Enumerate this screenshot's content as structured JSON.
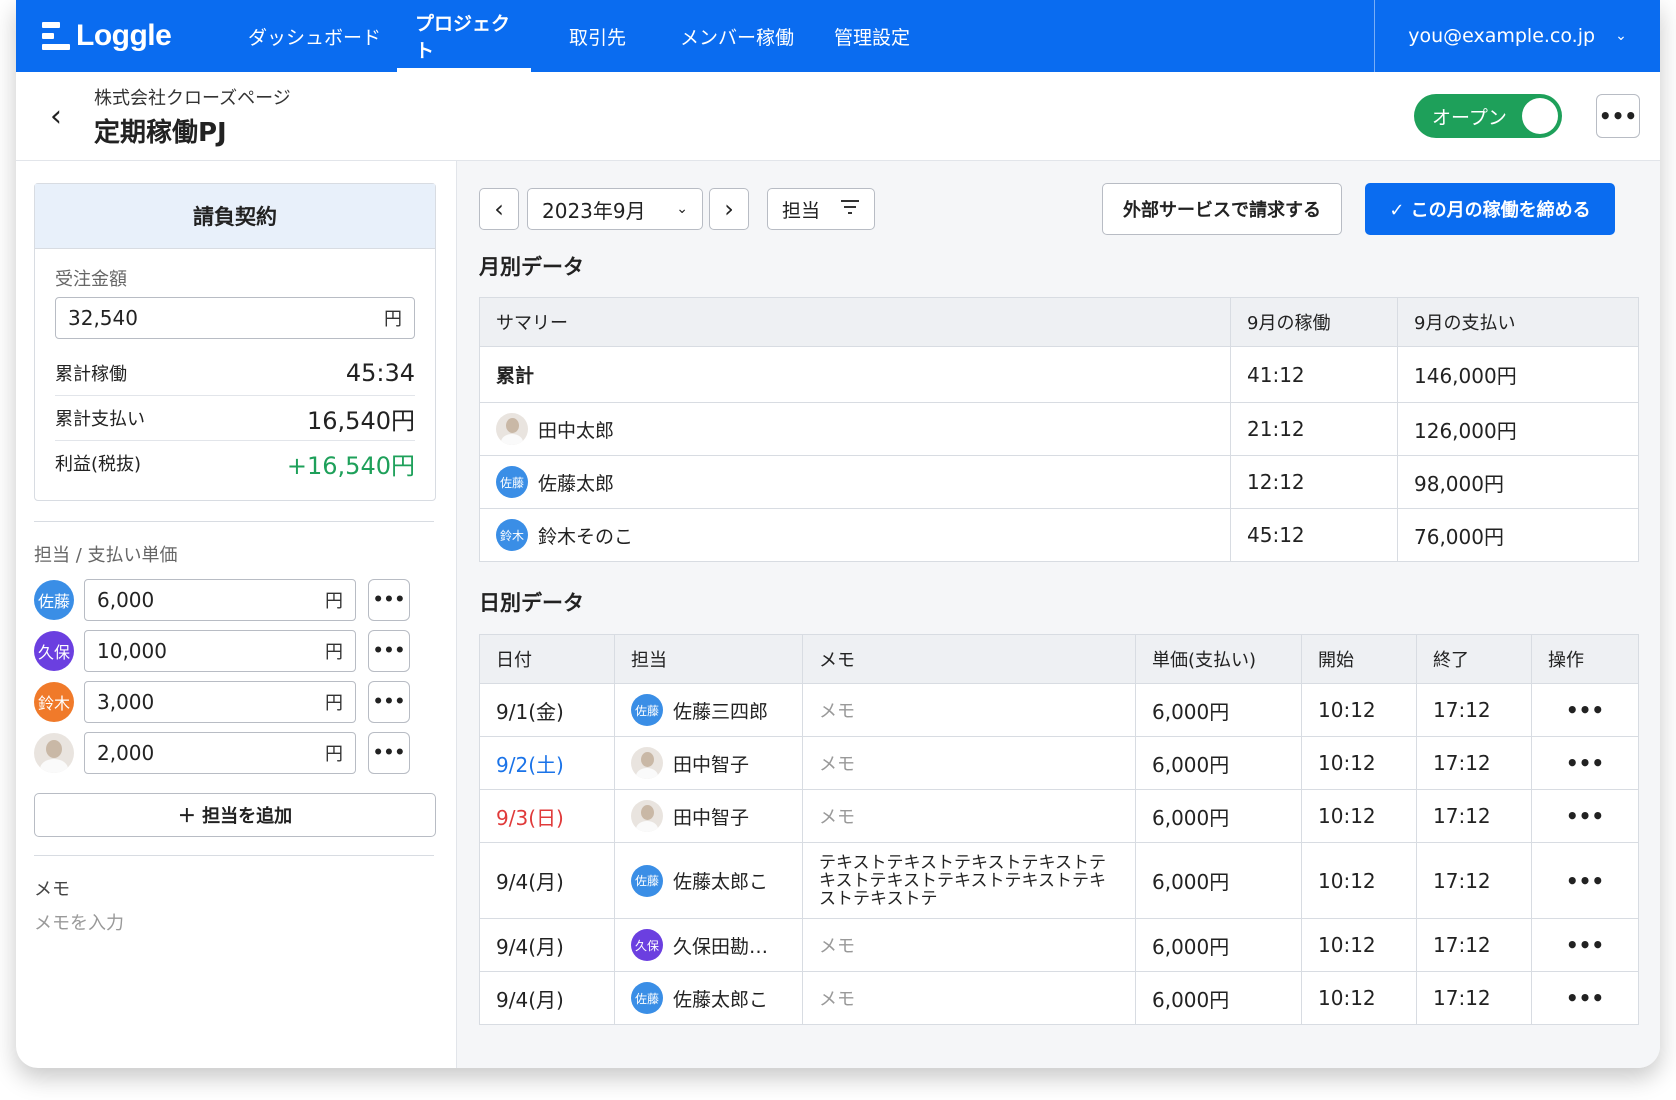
{
  "nav": {
    "logo": "Loggle",
    "items": [
      "ダッシュボード",
      "プロジェクト",
      "取引先",
      "メンバー稼働",
      "管理設定"
    ],
    "active_index": 1,
    "user_email": "you@example.co.jp"
  },
  "header": {
    "company": "株式会社クローズページ",
    "project": "定期稼働PJ",
    "status_toggle": "オープン",
    "more": "•••"
  },
  "contract": {
    "title": "請負契約",
    "amount_label": "受注金額",
    "amount_value": "32,540",
    "unit": "円",
    "stats": [
      {
        "label": "累計稼働",
        "value": "45:34"
      },
      {
        "label": "累計支払い",
        "value": "16,540円"
      },
      {
        "label": "利益(税抜)",
        "value": "+16,540円"
      }
    ]
  },
  "rates": {
    "label": "担当 / 支払い単価",
    "unit": "円",
    "more": "•••",
    "items": [
      {
        "avatar": "佐藤",
        "color": "#3a8ee6",
        "value": "6,000"
      },
      {
        "avatar": "久保",
        "color": "#6b3fe0",
        "value": "10,000"
      },
      {
        "avatar": "鈴木",
        "color": "#f07a2a",
        "value": "3,000"
      },
      {
        "avatar": "",
        "color": "photo",
        "value": "2,000"
      }
    ],
    "add_button": "＋ 担当を追加"
  },
  "memo": {
    "label": "メモ",
    "placeholder": "メモを入力"
  },
  "toolbar": {
    "prev": "‹",
    "month": "2023年9月",
    "next": "›",
    "filter": "担当",
    "external_button": "外部サービスで請求する",
    "close_button": "✓ この月の稼働を締める"
  },
  "monthly": {
    "title": "月別データ",
    "headers": [
      "サマリー",
      "9月の稼働",
      "9月の支払い"
    ],
    "total": {
      "label": "累計",
      "hours": "41:12",
      "pay": "146,000円"
    },
    "rows": [
      {
        "avatar": "",
        "color": "photo",
        "name": "田中太郎",
        "hours": "21:12",
        "pay": "126,000円"
      },
      {
        "avatar": "佐藤",
        "color": "#3a8ee6",
        "name": "佐藤太郎",
        "hours": "12:12",
        "pay": "98,000円"
      },
      {
        "avatar": "鈴木",
        "color": "#3a8ee6",
        "name": "鈴木そのこ",
        "hours": "45:12",
        "pay": "76,000円"
      }
    ]
  },
  "daily": {
    "title": "日別データ",
    "headers": [
      "日付",
      "担当",
      "メモ",
      "単価(支払い)",
      "開始",
      "終了",
      "操作"
    ],
    "rows": [
      {
        "date": "9/1(金)",
        "day": "weekday",
        "avatar": "佐藤",
        "color": "#3a8ee6",
        "name": "佐藤三四郎",
        "memo": "メモ",
        "memo_is_placeholder": true,
        "rate": "6,000円",
        "start": "10:12",
        "end": "17:12",
        "op": "•••"
      },
      {
        "date": "9/2(土)",
        "day": "sat",
        "avatar": "",
        "color": "photo",
        "name": "田中智子",
        "memo": "メモ",
        "memo_is_placeholder": true,
        "rate": "6,000円",
        "start": "10:12",
        "end": "17:12",
        "op": "•••"
      },
      {
        "date": "9/3(日)",
        "day": "sun",
        "avatar": "",
        "color": "photo",
        "name": "田中智子",
        "memo": "メモ",
        "memo_is_placeholder": true,
        "rate": "6,000円",
        "start": "10:12",
        "end": "17:12",
        "op": "•••"
      },
      {
        "date": "9/4(月)",
        "day": "weekday",
        "avatar": "佐藤",
        "color": "#3a8ee6",
        "name": "佐藤太郎こ",
        "memo": "テキストテキストテキストテキストテキストテキストテキストテキストテキストテキストテ",
        "memo_is_placeholder": false,
        "rate": "6,000円",
        "start": "10:12",
        "end": "17:12",
        "op": "•••"
      },
      {
        "date": "9/4(月)",
        "day": "weekday",
        "avatar": "久保",
        "color": "#6b3fe0",
        "name": "久保田勘…",
        "memo": "メモ",
        "memo_is_placeholder": true,
        "rate": "6,000円",
        "start": "10:12",
        "end": "17:12",
        "op": "•••"
      },
      {
        "date": "9/4(月)",
        "day": "weekday",
        "avatar": "佐藤",
        "color": "#3a8ee6",
        "name": "佐藤太郎こ",
        "memo": "メモ",
        "memo_is_placeholder": true,
        "rate": "6,000円",
        "start": "10:12",
        "end": "17:12",
        "op": "•••"
      }
    ]
  }
}
